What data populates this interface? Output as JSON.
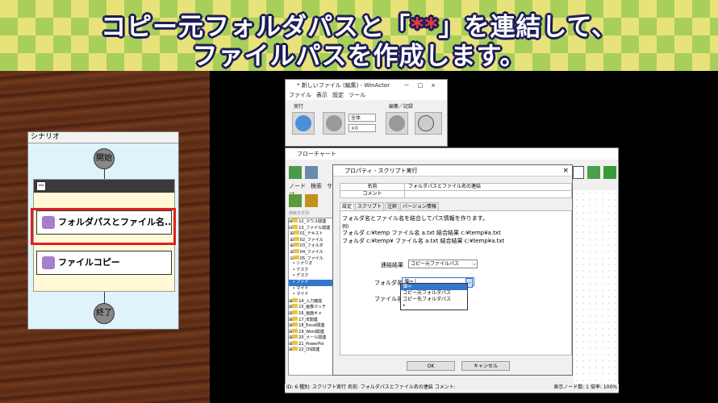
{
  "banner": {
    "line1_a": "コピー元フォルダパスと「",
    "line1_hl": "**",
    "line1_b": "」を連結して、",
    "line2": "ファイルパスを作成します。"
  },
  "scenario": {
    "header": "シナリオ",
    "start": "開始",
    "node1": "フォルダパスとファイル名...",
    "node2": "ファイルコピー",
    "end": "終了"
  },
  "winactor": {
    "title": "* 新しいファイル (編集) - WinActor",
    "menu": [
      "ファイル",
      "表示",
      "設定",
      "ツール"
    ],
    "group_run": "実行",
    "group_edit": "編集／記録",
    "sel_all": "全体",
    "sel_speed": "×0"
  },
  "flowchart": {
    "title": "フローチャート",
    "menu": [
      "ノード",
      "検索",
      "サブ"
    ],
    "search_placeholder": "検索文字列",
    "tree": [
      "12_マウス関連",
      "13_ファイル関連",
      "01_テキスト",
      "02_ファイル",
      "03_フォルダ",
      "04_ファイル",
      "05_ファイル",
      "シナリオ",
      "デスク",
      "デスク",
      "ファイ",
      "マイド",
      "マイド",
      "14_入力機能",
      "15_画像マッチ",
      "16_画面キャ",
      "17_IE関連",
      "18_Excel関連",
      "19_Word関連",
      "20_メール関連",
      "21_PowerPoi",
      "22_OS関連"
    ]
  },
  "dialog": {
    "title": "プロパティ - スクリプト実行",
    "name_label": "名前",
    "name_value": "フォルダパスとファイル名の連結",
    "comment_label": "コメント",
    "tabs": [
      "設定",
      "スクリプト",
      "注釈",
      "バージョン情報"
    ],
    "desc": "フォルダ名とファイル名を結合してパス情報を作ります。",
    "example_label": "例)",
    "example1": "フォルダ c:¥temp   ファイル名 a.txt   結合結果 c:¥temp¥a.txt",
    "example2": "フォルダ c:¥temp¥  ファイル名 a.txt   結合結果 c:¥temp¥a.txt",
    "result_label": "連結結果",
    "result_value": "コピー元ファイルパス",
    "folder_label": "フォルダ名",
    "folder_value": "値⇒ |",
    "file_label": "ファイル名",
    "options": [
      "値⇒",
      "コピー元フォルダパス",
      "コピー先フォルダパス",
      "•"
    ],
    "ok": "OK",
    "cancel": "キャンセル"
  },
  "statusbar": {
    "left": "ID: 6  種別: スクリプト実行  名前: フォルダパスとファイル名の連結  コメント:",
    "right": "表示ノード数: 1  倍率: 100%"
  }
}
